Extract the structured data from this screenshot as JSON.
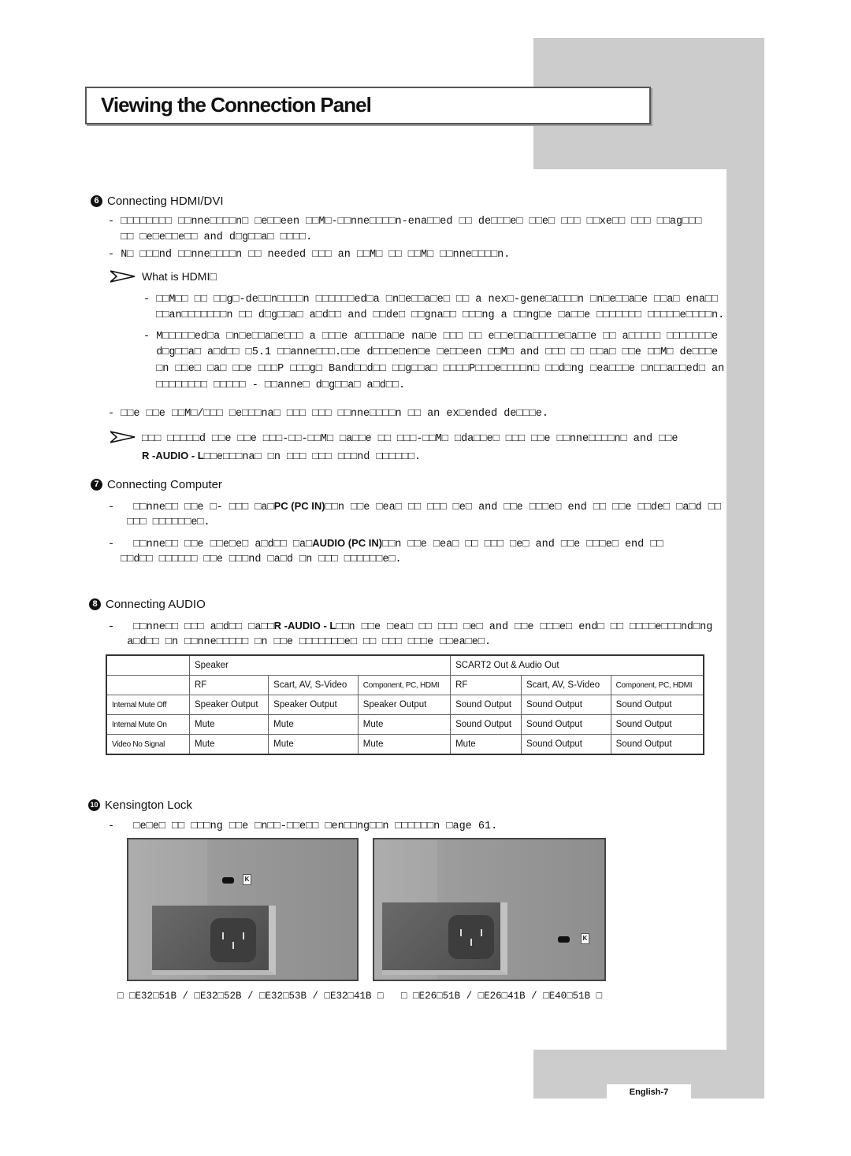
{
  "page_title": "Viewing the Connection Panel",
  "sections": {
    "hdmi": {
      "number": "6",
      "heading": "Connecting HDMI/DVI",
      "lines": [
        "- □□□□□□□□ □□nne□□□□n□ □e□□een □□M□-□□nne□□□□n-ena□□ed □□ de□□□e□ □□e□ □□□ □□xe□□ □□□ □□ag□□□",
        "  □□ □e□e□□e□□ and d□g□□a□ □□□□.",
        "- N□ □□□nd □□nne□□□□n □□ needed □□□ an □□M□ □□ □□M□ □□nne□□□□n."
      ],
      "note_heading": "What is HDMI□",
      "note_lines": [
        "- □□M□□ □□ □□g□-de□□n□□□□n □□□□□□ed□a □n□e□□a□e□ □□ a nex□-gene□a□□□n □n□e□□a□e □□a□ ena□□",
        "  □□an□□□□□□□n □□ d□g□□a□ a□d□□ and □□de□ □□gna□□ □□□ng a □□ng□e □a□□e □□□□□□□ □□□□□e□□□□n.",
        "- M□□□□□ed□a □n□e□□a□e□□□ a □□□e a□□□□a□e na□e □□□ □□ e□□e□□a□□□□e□a□□e □□ a□□□□□ □□□□□□□e",
        "  d□g□□a□ a□d□□ □5.1 □□anne□□□.□□e d□□□e□en□e □e□□een □□M□ and □□□ □□ □□a□ □□e □□M□ de□□□e",
        "  □n □□e□ □a□ □□e □□□P □□□g□ Band□□d□□ □□g□□a□ □□□□P□□□e□□□□n□ □□d□ng □ea□□□e □n□□a□□ed□ an",
        "  □□□□□□□□ □□□□□ - □□anne□ d□g□□a□ a□d□□."
      ],
      "extra_line": "- □□e □□e □□M□/□□□ □e□□□na□ □□□ □□□ □□nne□□□□n □□ an ex□ended de□□□e.",
      "note2_line1": "□□□ □□□□□d □□e □□e □□□-□□-□□M□ □a□□e □□ □□□-□□M□ □da□□e□ □□□ □□e □□nne□□□□n□ and □□e",
      "note2_kw": "R -AUDIO - L",
      "note2_line2": "□□e□□□na□ □n □□□ □□□ □□□nd □□□□□□."
    },
    "computer": {
      "number": "7",
      "heading": "Connecting Computer",
      "line1a": "-   □□nne□□ □□e □- □□□ □a□",
      "line1_kw": "PC (PC IN)",
      "line1b": "□□n □□e □ea□ □□ □□□ □e□ and □□e □□□e□ end □□ □□e □□de□ □a□d □□",
      "line1c": "   □□□ □□□□□□e□.",
      "line2a": "-   □□nne□□ □□e □□e□e□ a□d□□ □a□",
      "line2_kw": "AUDIO (PC IN)",
      "line2b": "□□n □□e □ea□ □□ □□□ □e□ and □□e □□□e□ end □□",
      "line2c": "  □□d□□ □□□□□□ □□e □□□nd □a□d □n □□□ □□□□□□e□."
    },
    "audio": {
      "number": "8",
      "heading": "Connecting AUDIO",
      "line1a": "-   □□nne□□ □□□ a□d□□ □a□□",
      "line1_kw": "R -AUDIO - L",
      "line1b": "□□n □□e □ea□ □□ □□□ □e□ and □□e □□□e□ end□ □□ □□□□e□□□nd□ng",
      "line1c": "   a□d□□ □n □□nne□□□□□ □n □□e □□□□□□□e□ □□ □□□ □□□e □□ea□e□.",
      "table": {
        "group_headers": [
          "",
          "Speaker",
          "SCART2 Out & Audio Out"
        ],
        "sub_headers": [
          "",
          "RF",
          "Scart, AV, S-Video",
          "Component, PC, HDMI",
          "RF",
          "Scart, AV, S-Video",
          "Component, PC, HDMI"
        ],
        "rows": [
          [
            "Internal Mute Off",
            "Speaker Output",
            "Speaker Output",
            "Speaker Output",
            "Sound Output",
            "Sound Output",
            "Sound Output"
          ],
          [
            "Internal Mute On",
            "Mute",
            "Mute",
            "Mute",
            "Sound Output",
            "Sound Output",
            "Sound Output"
          ],
          [
            "Video No Signal",
            "Mute",
            "Mute",
            "Mute",
            "Mute",
            "Sound Output",
            "Sound Output"
          ]
        ]
      }
    },
    "kensington": {
      "number": "10",
      "heading": "Kensington Lock",
      "line": "-   □e□e□ □□ □□□ng □□e □n□□-□□e□□ □en□□ng□□n □□□□□□n □age 61.",
      "lock_label": "K",
      "caption": "□ □E32□51B / □E32□52B / □E32□53B / □E32□41B □   □ □E26□51B / □E26□41B / □E40□51B □"
    }
  },
  "footer": {
    "page_label": "English-7"
  },
  "colors": {
    "side_gray": "#cccccc",
    "title_border": "#555555"
  }
}
